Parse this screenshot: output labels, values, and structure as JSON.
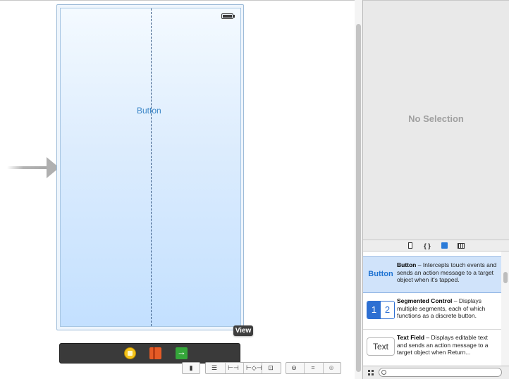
{
  "canvas": {
    "screen_button_label": "Button",
    "tooltip": "View"
  },
  "dock": {
    "icons": [
      "first-responder-icon",
      "view-controller-icon",
      "exit-icon"
    ]
  },
  "inspector": {
    "empty_label": "No Selection"
  },
  "library_tabs": {
    "code_tab_label": "{ }"
  },
  "library": {
    "items": [
      {
        "thumb": "Button",
        "title": "Button",
        "description": " – Intercepts touch events and sends an action message to a target object when it's tapped."
      },
      {
        "thumb_left": "1",
        "thumb_right": "2",
        "title": "Segmented Control",
        "description": " – Displays multiple segments, each of which functions as a discrete button."
      },
      {
        "thumb": "Text",
        "title": "Text Field",
        "description": " – Displays editable text and sends an action message to a target object when Return..."
      }
    ],
    "filter_placeholder": ""
  },
  "colors": {
    "accent": "#1f73d2",
    "selection": "#d0e3fa"
  }
}
